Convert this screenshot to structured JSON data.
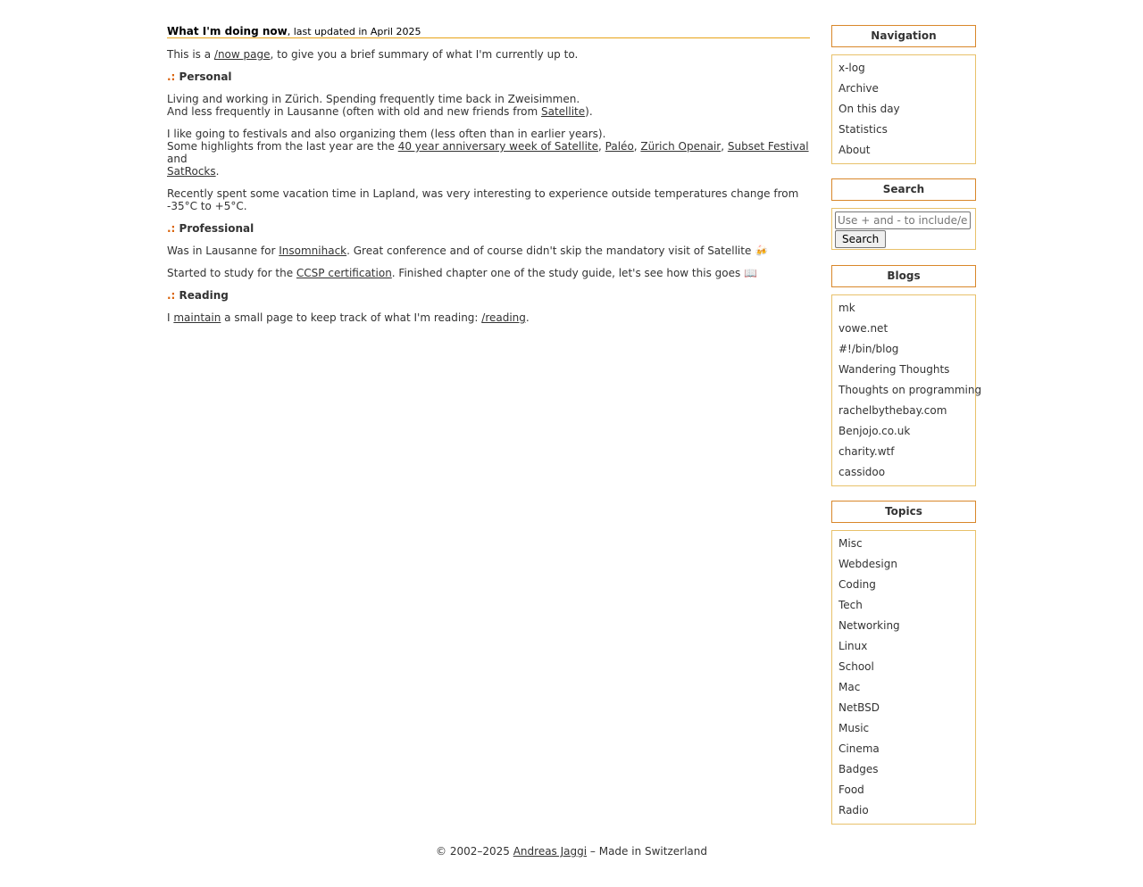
{
  "header": {
    "title": "What I'm doing now",
    "updated": ", last updated in April 2025"
  },
  "intro": {
    "before": "This is a ",
    "link": "/now page",
    "after": ", to give you a brief summary of what I'm currently up to."
  },
  "sections": {
    "marker": ".:",
    "personal": "Personal",
    "professional": "Professional",
    "reading": "Reading"
  },
  "personal": {
    "p1_line1": "Living and working in Zürich. Spending frequently time back in Zweisimmen.",
    "p1_line2_before": "And less frequently in Lausanne (often with old and new friends from ",
    "p1_line2_link": "Satellite",
    "p1_line2_after": ").",
    "p2_line1": "I like going to festivals and also organizing them (less often than in earlier years).",
    "p2_line2_before": "Some highlights from the last year are the ",
    "p2_link1": "40 year anniversary week of Satellite",
    "p2_sep1": ", ",
    "p2_link2": "Paléo",
    "p2_sep2": ", ",
    "p2_link3": "Zürich Openair",
    "p2_sep3": ", ",
    "p2_link4": "Subset Festival",
    "p2_and": " and",
    "p2_link5": "SatRocks",
    "p2_end": ".",
    "p3": "Recently spent some vacation time in Lapland, was very interesting to experience outside temperatures change from -35°C to +5°C."
  },
  "professional": {
    "p1_before": "Was in Lausanne for ",
    "p1_link": "Insomnihack",
    "p1_after": ". Great conference and of course didn't skip the mandatory visit of Satellite 🍻",
    "p2_before": "Started to study for the ",
    "p2_link": "CCSP certification",
    "p2_after": ". Finished chapter one of the study guide, let's see how this goes 📖"
  },
  "reading": {
    "before": "I ",
    "link1": "maintain",
    "middle": " a small page to keep track of what I'm reading: ",
    "link2": "/reading",
    "after": "."
  },
  "sidebar": {
    "navigation": {
      "title": "Navigation",
      "items": [
        "x-log",
        "Archive",
        "On this day",
        "Statistics",
        "About"
      ]
    },
    "search": {
      "title": "Search",
      "placeholder": "Use + and - to include/exclude",
      "button": "Search"
    },
    "blogs": {
      "title": "Blogs",
      "items": [
        "mk",
        "vowe.net",
        "#!/bin/blog",
        "Wandering Thoughts",
        "Thoughts on programming",
        "rachelbythebay.com",
        "Benjojo.co.uk",
        "charity.wtf",
        "cassidoo"
      ]
    },
    "topics": {
      "title": "Topics",
      "items": [
        "Misc",
        "Webdesign",
        "Coding",
        "Tech",
        "Networking",
        "Linux",
        "School",
        "Mac",
        "NetBSD",
        "Music",
        "Cinema",
        "Badges",
        "Food",
        "Radio"
      ]
    }
  },
  "footer": {
    "before": "© 2002–2025 ",
    "link": "Andreas Jaggi",
    "after": " – Made in Switzerland"
  },
  "colors": {
    "accent": "#e8a317",
    "marker": "#d9620a",
    "text": "#333333"
  }
}
